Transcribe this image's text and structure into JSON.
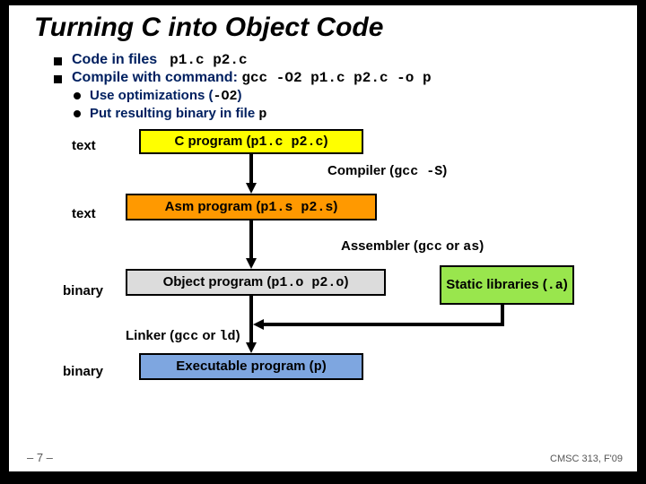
{
  "title": "Turning C into Object Code",
  "bullets": {
    "b0": {
      "pre": "Code in files ",
      "code": " p1.c p2.c"
    },
    "b1": {
      "pre": "Compile with command: ",
      "code": "gcc -O2 p1.c p2.c -o p"
    },
    "sub0": {
      "pre": "Use optimizations (",
      "code": "-O2",
      "post": ")"
    },
    "sub1": {
      "pre": "Put resulting binary in file ",
      "code": "p"
    }
  },
  "diagram": {
    "side0": "text",
    "side1": "text",
    "side2": "binary",
    "side3": "binary",
    "box_c": {
      "pre": "C program (",
      "code": "p1.c p2.c",
      "post": ")"
    },
    "box_asm": {
      "pre": "Asm program (",
      "code": "p1.s p2.s",
      "post": ")"
    },
    "box_obj": {
      "pre": "Object program (",
      "code": "p1.o p2.o",
      "post": ")"
    },
    "box_lib": {
      "pre": "Static libraries (",
      "code": ".a",
      "post": ")"
    },
    "box_exe": {
      "pre": "Executable program (",
      "code": "p",
      "post": ")"
    },
    "step_compiler": {
      "pre": "Compiler (",
      "code": "gcc -S",
      "post": ")"
    },
    "step_assembler": {
      "pre": "Assembler (",
      "code_a": "gcc",
      "mid": " or ",
      "code_b": "as",
      "post": ")"
    },
    "step_linker": {
      "pre": "Linker (",
      "code_a": "gcc",
      "mid": " or ",
      "code_b": "ld",
      "post": ")"
    }
  },
  "footer": {
    "left": "– 7 –",
    "right": "CMSC 313, F'09"
  }
}
